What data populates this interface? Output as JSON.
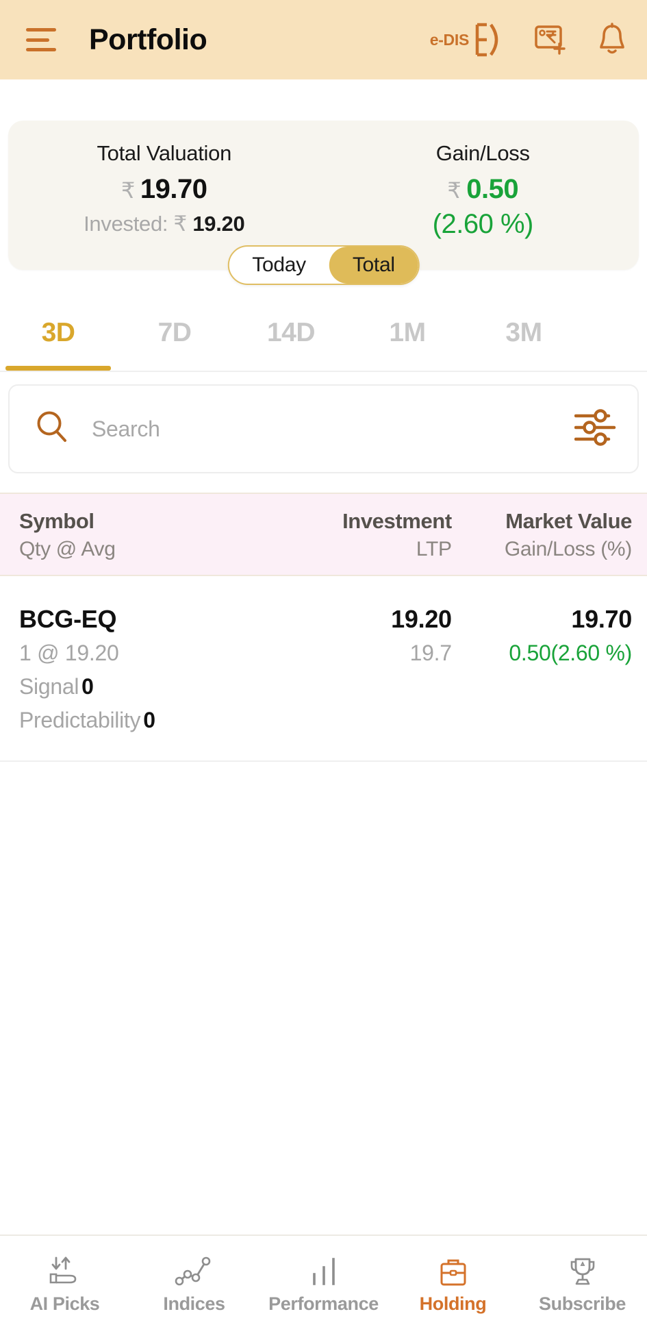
{
  "header": {
    "title": "Portfolio",
    "menu_icon": "hamburger-menu-icon",
    "edis_label": "e-DIS",
    "edis_icon": "edis-bracket-icon",
    "fund_icon": "add-funds-rupee-icon",
    "bell_icon": "notification-bell-icon",
    "bg_color": "#F8E2BC",
    "accent_color": "#C9712A"
  },
  "summary": {
    "valuation_label": "Total Valuation",
    "valuation_currency": "₹",
    "valuation_value": "19.70",
    "invested_prefix": "Invested:",
    "invested_currency": "₹",
    "invested_value": "19.20",
    "gainloss_label": "Gain/Loss",
    "gainloss_currency": "₹",
    "gainloss_value": "0.50",
    "gainloss_pct": "(2.60 %)",
    "gain_color": "#19A339",
    "card_bg": "#F7F5EF",
    "toggle": {
      "options": [
        {
          "label": "Today",
          "active": false
        },
        {
          "label": "Total",
          "active": true
        }
      ],
      "active_bg": "#DFBB59",
      "border_color": "#E0BE63"
    }
  },
  "period_tabs": {
    "active_color": "#D9A72C",
    "items": [
      {
        "label": "3D",
        "active": true
      },
      {
        "label": "7D",
        "active": false
      },
      {
        "label": "14D",
        "active": false
      },
      {
        "label": "1M",
        "active": false
      },
      {
        "label": "3M",
        "active": false
      }
    ]
  },
  "search": {
    "placeholder": "Search",
    "value": "",
    "search_icon": "search-icon",
    "filter_icon": "filter-sliders-icon"
  },
  "table": {
    "header_bg": "#FCF0F7",
    "columns": [
      {
        "main": "Symbol",
        "sub": "Qty @ Avg"
      },
      {
        "main": "Investment",
        "sub": "LTP"
      },
      {
        "main": "Market Value",
        "sub": "Gain/Loss (%)"
      }
    ],
    "rows": [
      {
        "symbol": "BCG-EQ",
        "qty_at_avg": "1 @ 19.20",
        "signal_label": "Signal",
        "signal_value": "0",
        "predictability_label": "Predictability",
        "predictability_value": "0",
        "investment": "19.20",
        "ltp": "19.7",
        "market_value": "19.70",
        "gain_loss": "0.50(2.60 %)",
        "gain_loss_positive": true
      }
    ]
  },
  "bottom_nav": {
    "active_color": "#D4722A",
    "items": [
      {
        "label": "AI Picks",
        "icon": "ai-picks-hand-arrows-icon",
        "active": false
      },
      {
        "label": "Indices",
        "icon": "indices-line-chart-icon",
        "active": false
      },
      {
        "label": "Performance",
        "icon": "performance-bar-chart-icon",
        "active": false
      },
      {
        "label": "Holding",
        "icon": "holding-briefcase-icon",
        "active": true
      },
      {
        "label": "Subscribe",
        "icon": "subscribe-trophy-icon",
        "active": false
      }
    ]
  }
}
